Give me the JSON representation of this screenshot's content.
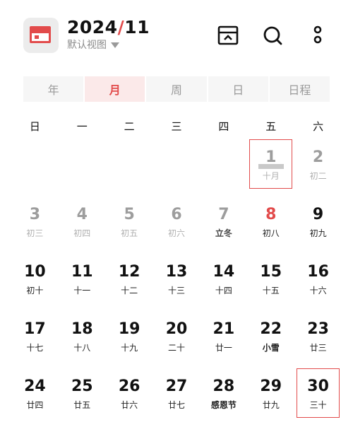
{
  "header": {
    "year_month": "2024",
    "slash": "/",
    "month": "11",
    "view_label": "默认视图"
  },
  "tabs": [
    {
      "label": "年",
      "active": false
    },
    {
      "label": "月",
      "active": true
    },
    {
      "label": "周",
      "active": false
    },
    {
      "label": "日",
      "active": false
    },
    {
      "label": "日程",
      "active": false
    }
  ],
  "weekdays": [
    "日",
    "一",
    "二",
    "三",
    "四",
    "五",
    "六"
  ],
  "weeks": [
    [
      {
        "num": "",
        "lunar": ""
      },
      {
        "num": "",
        "lunar": ""
      },
      {
        "num": "",
        "lunar": ""
      },
      {
        "num": "",
        "lunar": ""
      },
      {
        "num": "",
        "lunar": ""
      },
      {
        "num": "1",
        "lunar": "十月"
      },
      {
        "num": "2",
        "lunar": "初二"
      }
    ],
    [
      {
        "num": "3",
        "lunar": "初三"
      },
      {
        "num": "4",
        "lunar": "初四"
      },
      {
        "num": "5",
        "lunar": "初五"
      },
      {
        "num": "6",
        "lunar": "初六"
      },
      {
        "num": "7",
        "lunar": "立冬"
      },
      {
        "num": "8",
        "lunar": "初八"
      },
      {
        "num": "9",
        "lunar": "初九"
      }
    ],
    [
      {
        "num": "10",
        "lunar": "初十"
      },
      {
        "num": "11",
        "lunar": "十一"
      },
      {
        "num": "12",
        "lunar": "十二"
      },
      {
        "num": "13",
        "lunar": "十三"
      },
      {
        "num": "14",
        "lunar": "十四"
      },
      {
        "num": "15",
        "lunar": "十五"
      },
      {
        "num": "16",
        "lunar": "十六"
      }
    ],
    [
      {
        "num": "17",
        "lunar": "十七"
      },
      {
        "num": "18",
        "lunar": "十八"
      },
      {
        "num": "19",
        "lunar": "十九"
      },
      {
        "num": "20",
        "lunar": "二十"
      },
      {
        "num": "21",
        "lunar": "廿一"
      },
      {
        "num": "22",
        "lunar": "小雪"
      },
      {
        "num": "23",
        "lunar": "廿三"
      }
    ],
    [
      {
        "num": "24",
        "lunar": "廿四"
      },
      {
        "num": "25",
        "lunar": "廿五"
      },
      {
        "num": "26",
        "lunar": "廿六"
      },
      {
        "num": "27",
        "lunar": "廿七"
      },
      {
        "num": "28",
        "lunar": "感恩节"
      },
      {
        "num": "29",
        "lunar": "廿九"
      },
      {
        "num": "30",
        "lunar": "三十"
      }
    ]
  ],
  "colors": {
    "accent": "#e24b4b"
  }
}
